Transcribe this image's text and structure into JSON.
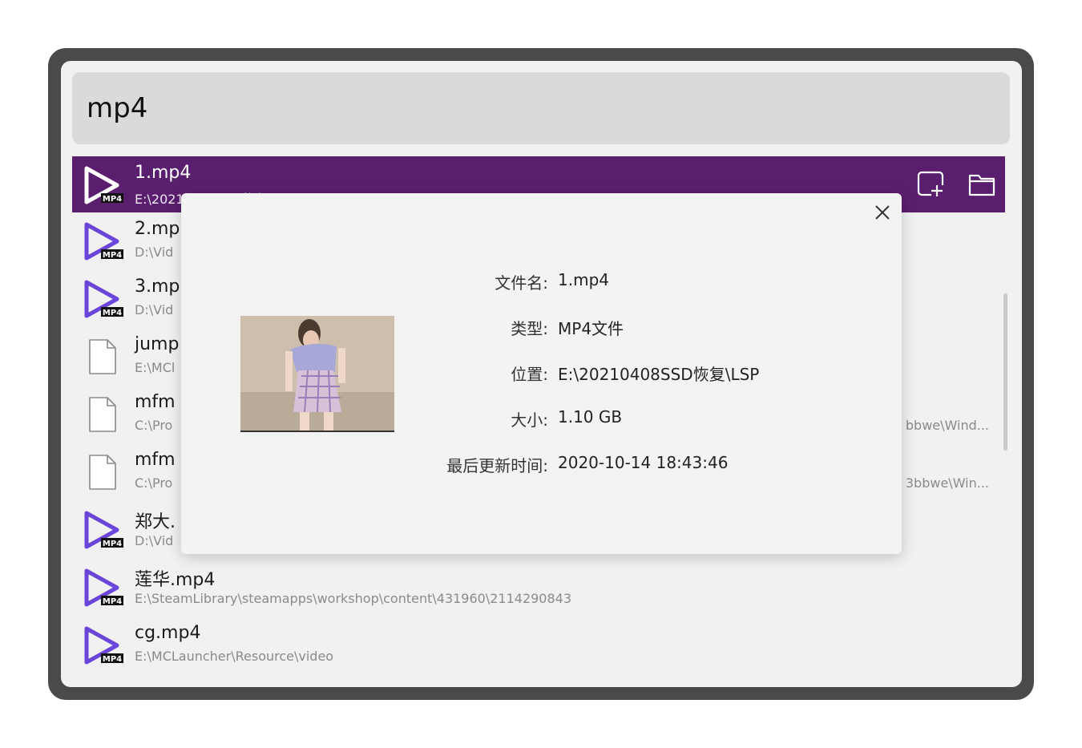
{
  "search": {
    "query": "mp4"
  },
  "results": [
    {
      "name": "1.mp4",
      "path": "E:\\20210408SSD恢复\\LSP",
      "icon": "mp4-file-icon",
      "selected": true
    },
    {
      "name": "2.mp",
      "path": "D:\\Vid",
      "icon": "mp4-file-icon"
    },
    {
      "name": "3.mp",
      "path": "D:\\Vid",
      "icon": "mp4-file-icon"
    },
    {
      "name": "jump",
      "path": "E:\\MCl",
      "icon": "generic-file-icon"
    },
    {
      "name": "mfm",
      "path": "C:\\Pro",
      "tail": "bbwe\\Wind...",
      "icon": "generic-file-icon"
    },
    {
      "name": "mfm",
      "path": "C:\\Pro",
      "tail": "3bbwe\\Win...",
      "icon": "generic-file-icon"
    },
    {
      "name": "郑大.",
      "path": "D:\\Vid",
      "icon": "mp4-file-icon"
    },
    {
      "name": "莲华.mp4",
      "path": "E:\\SteamLibrary\\steamapps\\workshop\\content\\431960\\2114290843",
      "icon": "mp4-file-icon"
    },
    {
      "name": "cg.mp4",
      "path": "E:\\MCLauncher\\Resource\\video",
      "icon": "mp4-file-icon"
    }
  ],
  "row_actions": {
    "icons": [
      "open-with-icon",
      "open-folder-icon"
    ]
  },
  "details": {
    "filename_label": "文件名:",
    "filename_value": "1.mp4",
    "type_label": "类型:",
    "type_value": "MP4文件",
    "location_label": "位置:",
    "location_value": "E:\\20210408SSD恢复\\LSP",
    "size_label": "大小:",
    "size_value": "1.10 GB",
    "modified_label": "最后更新时间:",
    "modified_value": "2020-10-14 18:43:46"
  },
  "colors": {
    "accent": "#5a1e6e",
    "mp4_icon": "#6b44d8"
  }
}
